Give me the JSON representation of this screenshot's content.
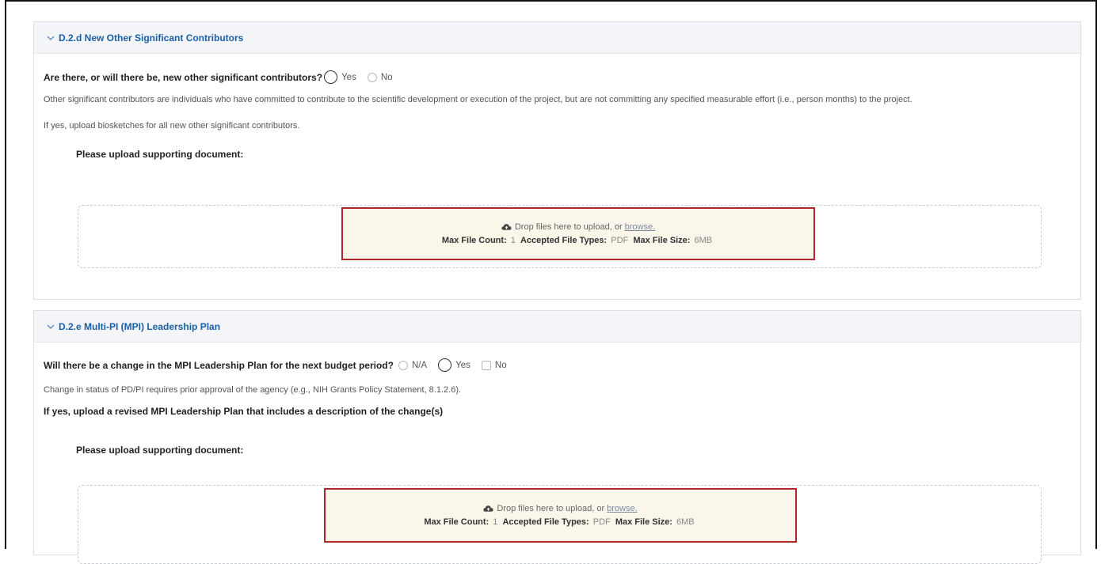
{
  "section1": {
    "header": "D.2.d New Other Significant Contributors",
    "question": "Are there, or will there be, new other significant contributors?",
    "options": [
      "Yes",
      "No"
    ],
    "description": "Other significant contributors are individuals who have committed to contribute to the scientific development or execution of the project, but are not committing any specified measurable effort (i.e., person months) to the project.",
    "instruction": "If yes, upload biosketches for all new other significant contributors.",
    "upload_label": "Please upload supporting document:",
    "dropzone": {
      "drop_text": "Drop files here to upload, or",
      "browse_link": "browse.",
      "max_count_label": "Max File Count:",
      "max_count_value": "1",
      "types_label": "Accepted File Types:",
      "types_value": "PDF",
      "size_label": "Max File Size:",
      "size_value": "6MB"
    }
  },
  "section2": {
    "header": "D.2.e Multi-PI (MPI) Leadership Plan",
    "question": "Will there be a change in the MPI Leadership Plan for the next budget period?",
    "options": [
      "N/A",
      "Yes",
      "No"
    ],
    "description": "Change in status of PD/PI requires prior approval of the agency (e.g., NIH Grants Policy Statement, 8.1.2.6).",
    "instruction": "If yes, upload a revised MPI Leadership Plan that includes a description of the change(s)",
    "upload_label": "Please upload supporting document:",
    "dropzone": {
      "drop_text": "Drop files here to upload, or",
      "browse_link": "browse.",
      "max_count_label": "Max File Count:",
      "max_count_value": "1",
      "types_label": "Accepted File Types:",
      "types_value": "PDF",
      "size_label": "Max File Size:",
      "size_value": "6MB"
    }
  },
  "icons": {
    "chevron": "chevron-down-icon",
    "cloud": "cloud-upload-icon"
  },
  "colors": {
    "header_text": "#1a5fa6",
    "highlight_border": "#b0262b",
    "dropzone_fill": "#fbf6ea"
  }
}
